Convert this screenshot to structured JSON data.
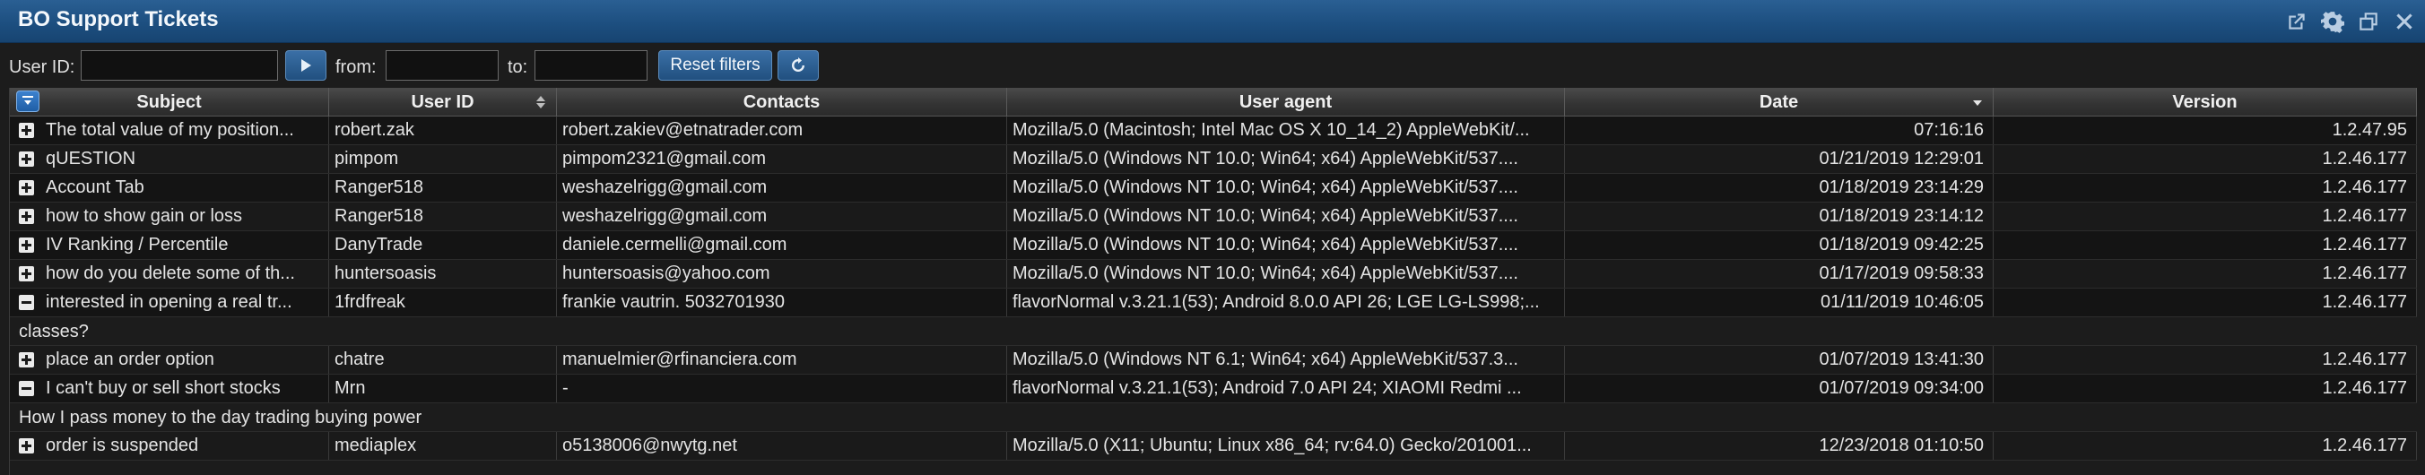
{
  "window": {
    "title": "BO Support Tickets",
    "controls": {
      "popout_icon": "external-link-icon",
      "settings_icon": "gear-icon",
      "restore_icon": "restore-window-icon",
      "close_icon": "close-icon"
    }
  },
  "toolbar": {
    "user_id_label": "User ID:",
    "user_id_value": "",
    "go_icon": "play-icon",
    "from_label": "from:",
    "from_value": "",
    "to_label": "to:",
    "to_value": "",
    "reset_label": "Reset filters",
    "refresh_icon": "refresh-icon"
  },
  "table": {
    "columns": [
      "Subject",
      "User ID",
      "Contacts",
      "User agent",
      "Date",
      "Version"
    ],
    "sorted_column": "Date",
    "sort_direction": "descending",
    "rows": [
      {
        "expanded": false,
        "subject": "The total value of my position...",
        "user_id": "robert.zak",
        "contacts": "robert.zakiev@etnatrader.com",
        "user_agent": "Mozilla/5.0 (Macintosh; Intel Mac OS X 10_14_2) AppleWebKit/...",
        "date": "07:16:16",
        "version": "1.2.47.95"
      },
      {
        "expanded": false,
        "subject": "qUESTION",
        "user_id": "pimpom",
        "contacts": "pimpom2321@gmail.com",
        "user_agent": "Mozilla/5.0 (Windows NT 10.0; Win64; x64) AppleWebKit/537....",
        "date": "01/21/2019 12:29:01",
        "version": "1.2.46.177"
      },
      {
        "expanded": false,
        "subject": "Account Tab",
        "user_id": "Ranger518",
        "contacts": "weshazelrigg@gmail.com",
        "user_agent": "Mozilla/5.0 (Windows NT 10.0; Win64; x64) AppleWebKit/537....",
        "date": "01/18/2019 23:14:29",
        "version": "1.2.46.177"
      },
      {
        "expanded": false,
        "subject": "how to show gain or loss",
        "user_id": "Ranger518",
        "contacts": "weshazelrigg@gmail.com",
        "user_agent": "Mozilla/5.0 (Windows NT 10.0; Win64; x64) AppleWebKit/537....",
        "date": "01/18/2019 23:14:12",
        "version": "1.2.46.177"
      },
      {
        "expanded": false,
        "subject": "IV Ranking / Percentile",
        "user_id": "DanyTrade",
        "contacts": "daniele.cermelli@gmail.com",
        "user_agent": "Mozilla/5.0 (Windows NT 10.0; Win64; x64) AppleWebKit/537....",
        "date": "01/18/2019 09:42:25",
        "version": "1.2.46.177"
      },
      {
        "expanded": false,
        "subject": "how do you delete some of th...",
        "user_id": "huntersoasis",
        "contacts": "huntersoasis@yahoo.com",
        "user_agent": "Mozilla/5.0 (Windows NT 10.0; Win64; x64) AppleWebKit/537....",
        "date": "01/17/2019 09:58:33",
        "version": "1.2.46.177"
      },
      {
        "expanded": true,
        "subject": "interested in opening a real tr...",
        "user_id": "1frdfreak",
        "contacts": "frankie vautrin. 5032701930",
        "user_agent": "flavorNormal v.3.21.1(53); Android 8.0.0 API 26; LGE LG-LS998;...",
        "date": "01/11/2019 10:46:05",
        "version": "1.2.46.177",
        "detail": "classes?"
      },
      {
        "expanded": false,
        "subject": "place an order option",
        "user_id": "chatre",
        "contacts": "manuelmier@rfinanciera.com",
        "user_agent": "Mozilla/5.0 (Windows NT 6.1; Win64; x64) AppleWebKit/537.3...",
        "date": "01/07/2019 13:41:30",
        "version": "1.2.46.177"
      },
      {
        "expanded": true,
        "subject": "I can't buy or sell short stocks",
        "user_id": "Mrn",
        "contacts": "-",
        "user_agent": "flavorNormal v.3.21.1(53); Android 7.0 API 24; XIAOMI Redmi ...",
        "date": "01/07/2019 09:34:00",
        "version": "1.2.46.177",
        "detail": "How I pass money to the day trading buying power"
      },
      {
        "expanded": false,
        "subject": "order is suspended",
        "user_id": "mediaplex",
        "contacts": "o5138006@nwytg.net",
        "user_agent": "Mozilla/5.0 (X11; Ubuntu; Linux x86_64; rv:64.0) Gecko/201001...",
        "date": "12/23/2018 01:10:50",
        "version": "1.2.46.177"
      }
    ]
  }
}
